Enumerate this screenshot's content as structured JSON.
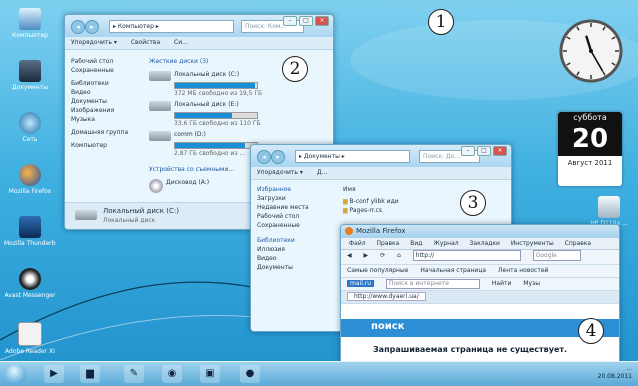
{
  "callouts": [
    "1",
    "2",
    "3",
    "4"
  ],
  "desktop_icons": [
    {
      "label": "Компьютер",
      "icon": "computer-icon"
    },
    {
      "label": "Документы",
      "icon": "documents-icon"
    },
    {
      "label": "Сеть",
      "icon": "network-icon"
    },
    {
      "label": "Mozilla Firefox",
      "icon": "firefox-icon"
    },
    {
      "label": "Mozilla Thunderbird",
      "icon": "thunderbird-icon"
    },
    {
      "label": "Avast Messenger",
      "icon": "messenger-icon"
    },
    {
      "label": "Adobe Reader XI",
      "icon": "adobe-reader-icon"
    }
  ],
  "explorer": {
    "address": "▸ Компьютер ▸",
    "search_placeholder": "Поиск: Ком...",
    "toolbar": [
      "Упорядочить ▾",
      "Свойства",
      "Си..."
    ],
    "nav": [
      "Рабочий стол",
      "Сохраненные",
      "Библиотеки",
      "Видео",
      "Документы",
      "Изображения",
      "Музыка",
      "Домашняя группа",
      "Компьютер"
    ],
    "group_hdd": "Жесткие диски (3)",
    "drives": [
      {
        "name": "Локальный диск (C:)",
        "info": "372 МБ свободно из 19,5 ГБ",
        "fill": 0.98
      },
      {
        "name": "Локальный диск (E:)",
        "info": "33,6 ГБ свободно из 110 ГБ",
        "fill": 0.69
      },
      {
        "name": "comm (D:)",
        "info": "2,87 ГБ свободно из ...",
        "fill": 0.85
      }
    ],
    "group_removable": "Устройства со съемными...",
    "dvd": "Дисковод (A:)",
    "footer_name": "Локальный диск (C:)",
    "footer_sub": "Локальный диск"
  },
  "docs": {
    "address": "▸ Документы ▸",
    "search_placeholder": "Поиск: До...",
    "toolbar": [
      "Упорядочить ▾",
      "Д..."
    ],
    "col_header": "Имя",
    "nav": [
      "Избранное",
      "Загрузки",
      "Недавние места",
      "Рабочий стол",
      "Сохраненные",
      "Библиотеки",
      "Иллюзия",
      "Видео",
      "Документы"
    ],
    "files": [
      "B-conf ylibk иди",
      "Pages-rr.cs"
    ]
  },
  "firefox": {
    "title": "Mozilla Firefox",
    "menu": [
      "Файл",
      "Правка",
      "Вид",
      "Журнал",
      "Закладки",
      "Инструменты",
      "Справка"
    ],
    "url": "http://",
    "search_placeholder": "Google",
    "bookmarks": [
      "Самые популярные",
      "Начальная страница",
      "Лента новостей"
    ],
    "toolbar_search_placeholder": "Поиск в интернете",
    "find_button": "Найти",
    "music_label": "Музы",
    "tab": "http://www.dyaeri.ua/",
    "logo": "поиск",
    "message": "Запрашиваемая страница не существует."
  },
  "gadgets": {
    "weekday": "суббота",
    "day": "20",
    "month": "Август 2011",
    "right_icon_label": "HP D110a ...",
    "clock_hour": 11,
    "clock_minute": 25
  },
  "taskbar": {
    "tray_time": "...",
    "tray_date": "20.08.2011"
  }
}
